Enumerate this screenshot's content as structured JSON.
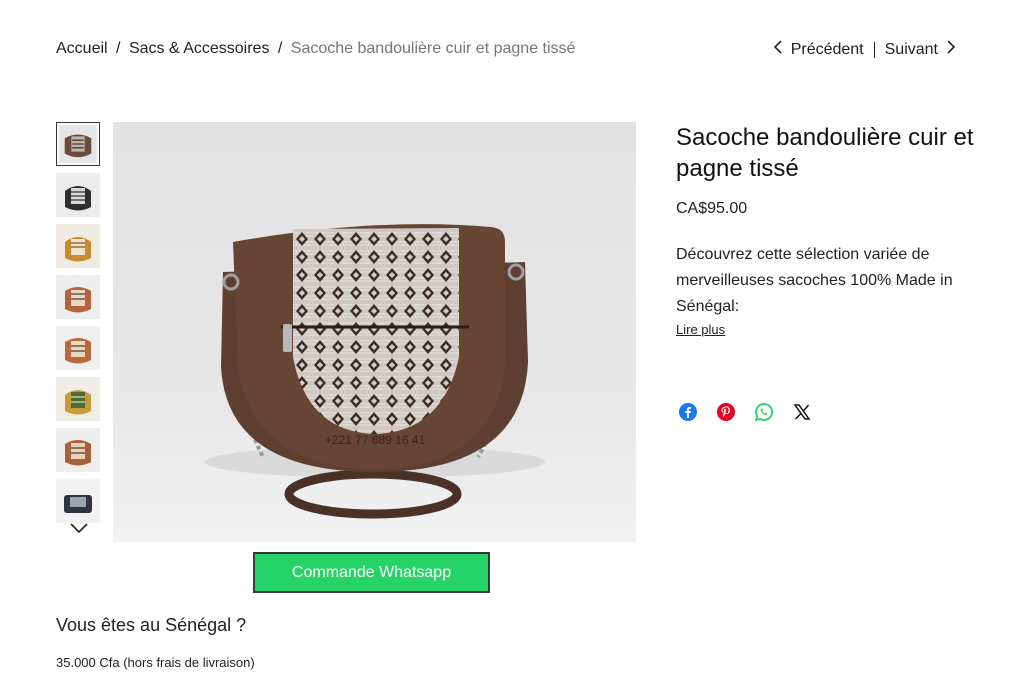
{
  "breadcrumb": {
    "home": "Accueil",
    "category": "Sacs & Accessoires",
    "current": "Sacoche bandoulière cuir et pagne tissé",
    "separator": "/"
  },
  "pager": {
    "prev": "Précédent",
    "next": "Suivant"
  },
  "product": {
    "title": "Sacoche bandoulière cuir et pagne tissé",
    "price": "CA$95.00",
    "description": "Découvrez cette sélection variée de merveilleuses sacoches 100% Made in Sénégal:",
    "read_more": "Lire plus"
  },
  "image": {
    "watermark_phone": "+221 77 689 16 41",
    "thumbnail_count": 8,
    "selected_thumbnail": 1
  },
  "cta": {
    "label": "Commande Whatsapp",
    "color": "#25d366"
  },
  "senegal": {
    "title": "Vous êtes au Sénégal ?",
    "price": "35.000 Cfa (hors frais de livraison)"
  },
  "share": [
    "facebook-icon",
    "pinterest-icon",
    "whatsapp-icon",
    "x-icon"
  ],
  "colors": {
    "leather": "#5e4032",
    "facebook": "#1877f2",
    "pinterest": "#e60023",
    "whatsapp": "#25d366"
  }
}
